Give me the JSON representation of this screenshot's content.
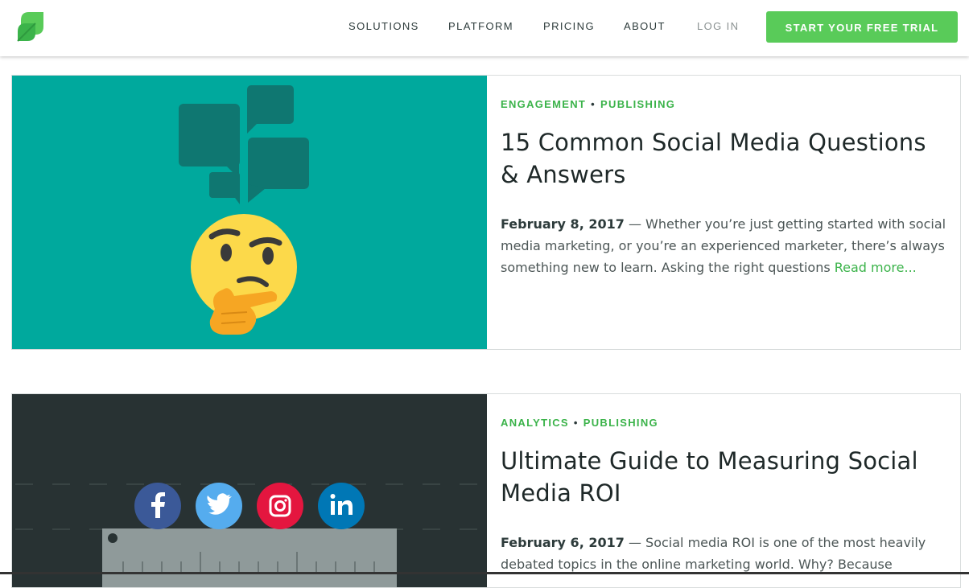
{
  "header": {
    "nav": [
      {
        "label": "SOLUTIONS"
      },
      {
        "label": "PLATFORM"
      },
      {
        "label": "PRICING"
      },
      {
        "label": "ABOUT"
      },
      {
        "label": "LOG IN"
      }
    ],
    "cta_label": "START YOUR FREE TRIAL"
  },
  "colors": {
    "brand_green": "#59cb59",
    "tag_green": "#3bb34a",
    "card1_bg": "#00a99d",
    "card2_bg": "#283233"
  },
  "articles": [
    {
      "tags": [
        "ENGAGEMENT",
        "PUBLISHING"
      ],
      "title": "15 Common Social Media Questions & Answers",
      "date": "February 8, 2017",
      "excerpt": " — Whether you’re just getting started with social media marketing, or you’re an experienced marketer, there’s always something new to learn. Asking the right questions ",
      "read_more": "Read more...",
      "image_icons": [
        "chat-bubbles-icon",
        "thinking-face-icon"
      ]
    },
    {
      "tags": [
        "ANALYTICS",
        "PUBLISHING"
      ],
      "title": "Ultimate Guide to Measuring Social Media ROI",
      "date": "February 6, 2017",
      "excerpt": " — Social media ROI is one of the most heavily debated topics in the online marketing world. Why? Because",
      "image_icons": [
        "facebook-icon",
        "twitter-icon",
        "instagram-icon",
        "linkedin-icon",
        "ruler-icon"
      ]
    }
  ]
}
